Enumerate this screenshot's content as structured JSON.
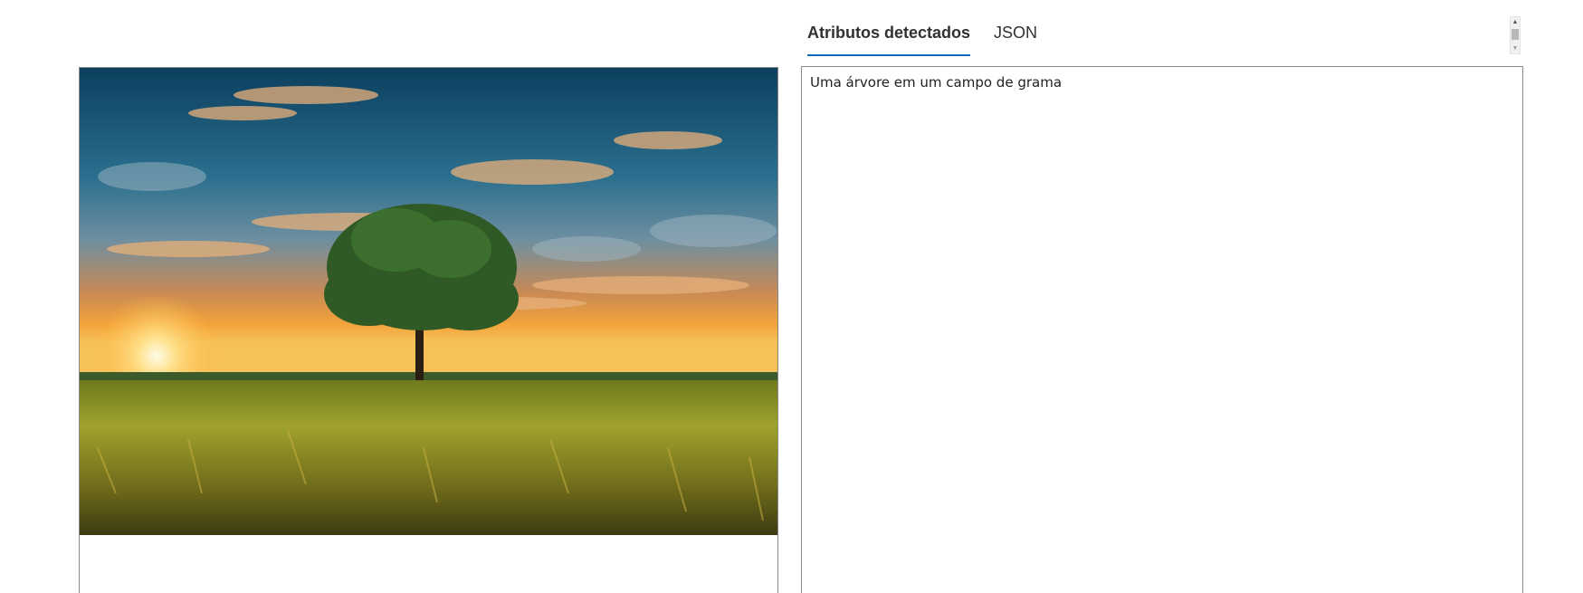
{
  "tabs": [
    {
      "label": "Atributos detectados",
      "active": true
    },
    {
      "label": "JSON",
      "active": false
    }
  ],
  "result": {
    "text": "Uma árvore em um campo de grama"
  },
  "image": {
    "subject": "tree-in-wheat-field-at-sunset"
  },
  "colors": {
    "accent": "#0f6cbd",
    "border": "#8a8a8a"
  }
}
